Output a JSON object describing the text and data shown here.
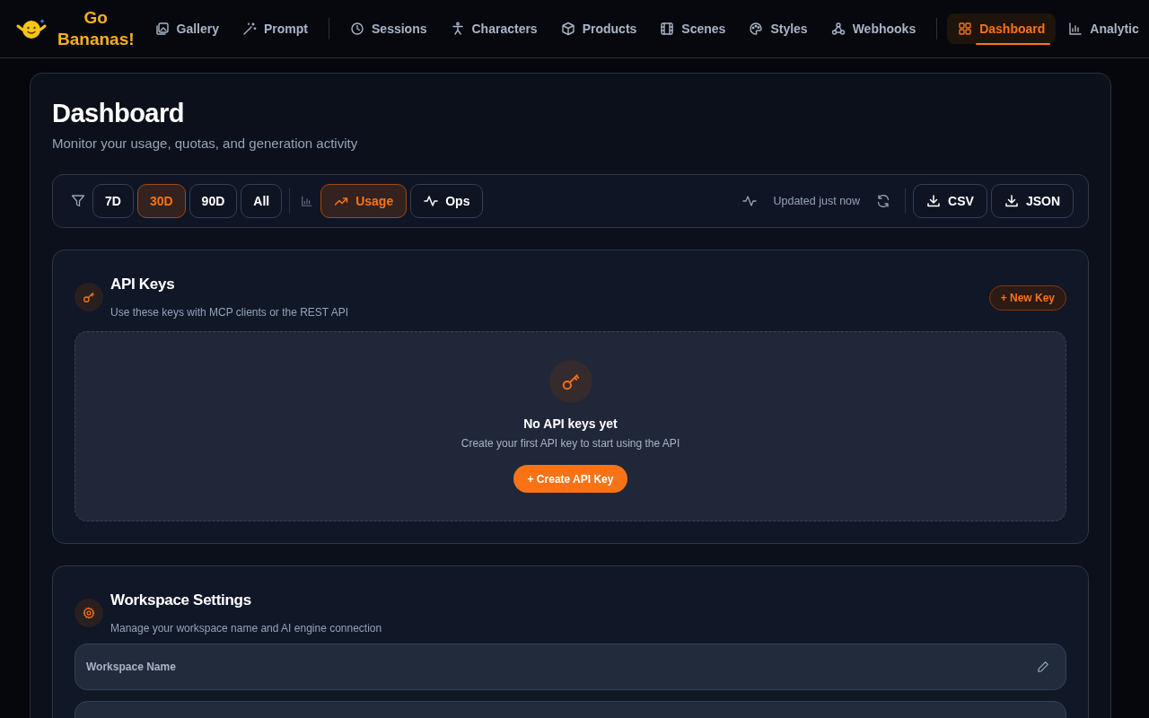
{
  "brand": {
    "name_line_1": "Go",
    "name_line_2": "Bananas!"
  },
  "nav": [
    {
      "label": "Gallery",
      "selected": false
    },
    {
      "label": "Prompt",
      "selected": false
    },
    {
      "label": "Sessions",
      "selected": false
    },
    {
      "label": "Characters",
      "selected": false
    },
    {
      "label": "Products",
      "selected": false
    },
    {
      "label": "Scenes",
      "selected": false
    },
    {
      "label": "Styles",
      "selected": false
    },
    {
      "label": "Webhooks",
      "selected": false
    },
    {
      "label": "Dashboard",
      "selected": true
    },
    {
      "label": "Analytic",
      "selected": false
    }
  ],
  "page": {
    "title": "Dashboard",
    "subtitle": "Monitor your usage, quotas, and generation activity"
  },
  "toolbar": {
    "ranges": [
      {
        "label": "7D",
        "selected": false
      },
      {
        "label": "30D",
        "selected": true
      },
      {
        "label": "90D",
        "selected": false
      },
      {
        "label": "All",
        "selected": false
      }
    ],
    "views": [
      {
        "label": "Usage",
        "selected": true
      },
      {
        "label": "Ops",
        "selected": false
      }
    ],
    "status": "Updated just now",
    "exports": [
      "CSV",
      "JSON"
    ]
  },
  "api_keys": {
    "title": "API Keys",
    "subtitle": "Use these keys with MCP clients or the REST API",
    "new_button": "+ New Key",
    "empty": {
      "title": "No API keys yet",
      "text": "Create your first API key to start using the API",
      "button": "+ Create API Key"
    }
  },
  "workspace": {
    "title": "Workspace Settings",
    "subtitle": "Manage your workspace name and AI engine connection",
    "field_label": "Workspace Name"
  }
}
